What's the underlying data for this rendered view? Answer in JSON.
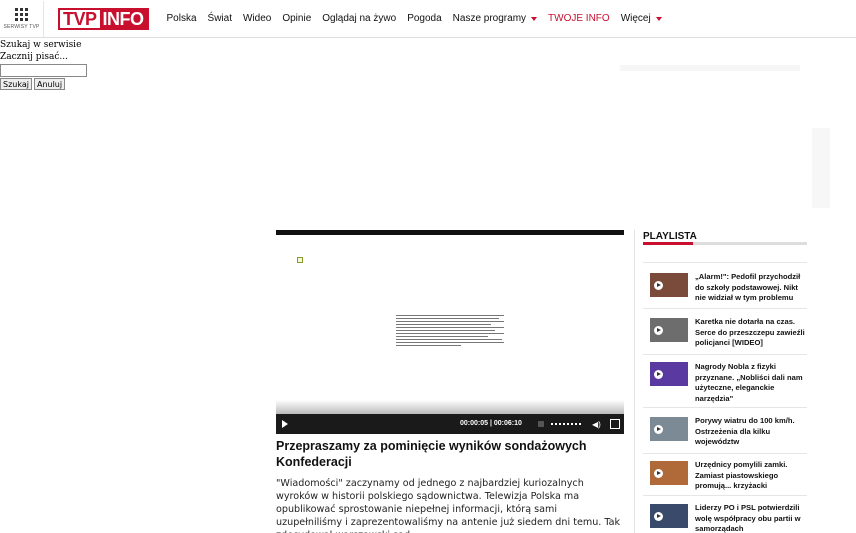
{
  "header": {
    "services_label": "SERWISY TVP",
    "logo_left": "TVP",
    "logo_right": "INFO",
    "nav": [
      {
        "label": "Polska",
        "dropdown": false,
        "accent": false
      },
      {
        "label": "Świat",
        "dropdown": false,
        "accent": false
      },
      {
        "label": "Wideo",
        "dropdown": false,
        "accent": false
      },
      {
        "label": "Opinie",
        "dropdown": false,
        "accent": false
      },
      {
        "label": "Oglądaj na żywo",
        "dropdown": false,
        "accent": false
      },
      {
        "label": "Pogoda",
        "dropdown": false,
        "accent": false
      },
      {
        "label": "Nasze programy",
        "dropdown": true,
        "accent": false
      },
      {
        "label": "TWOJE INFO",
        "dropdown": false,
        "accent": true
      },
      {
        "label": "Więcej",
        "dropdown": true,
        "accent": false
      }
    ]
  },
  "search": {
    "title": "Szukaj w serwisie",
    "hint": "Zacznij pisać...",
    "submit": "Szukaj",
    "cancel": "Anuluj"
  },
  "player": {
    "time": "00:00:05 | 00:06:10"
  },
  "article": {
    "headline": "Przepraszamy za pominięcie wyników sondażowych Konfederacji",
    "lead": "\"Wiadomości\" zaczynamy od jednego z najbardziej kuriozalnych wyroków w historii polskiego sądownictwa. Telewizja Polska ma opublikować sprostowanie niepełnej informacji, którą sami uzupełniliśmy i zaprezentowaliśmy na antenie już siedem dni temu. Tak zdecydował warszawski sąd."
  },
  "playlist": {
    "title": "PLAYLISTA",
    "items": [
      {
        "title": "„Alarm!\": Pedofil przychodził do szkoły podstawowej. Nikt nie widział w tym problemu",
        "thumb_color": "#7a4a3a"
      },
      {
        "title": "Karetka nie dotarła na czas. Serce do przeszczepu zawieźli policjanci [WIDEO]",
        "thumb_color": "#6d6d6d"
      },
      {
        "title": "Nagrody Nobla z fizyki przyznane. „Nobliści dali nam użyteczne, eleganckie narzędzia\"",
        "thumb_color": "#5a3aa0"
      },
      {
        "title": "Porywy wiatru do 100 km/h. Ostrzeżenia dla kilku województw",
        "thumb_color": "#7c8a96"
      },
      {
        "title": "Urzędnicy pomylili zamki. Zamiast piastowskiego promują... krzyżacki",
        "thumb_color": "#b06a3a"
      },
      {
        "title": "Liderzy PO i PSL potwierdzili wolę współpracy obu partii w samorządach",
        "thumb_color": "#3a4a6a"
      }
    ]
  }
}
